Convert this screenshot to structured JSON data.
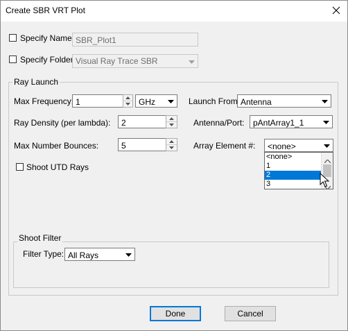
{
  "window": {
    "title": "Create SBR VRT Plot"
  },
  "specify_name": {
    "label": "Specify Name",
    "value": "SBR_Plot1"
  },
  "specify_folder": {
    "label": "Specify Folder",
    "value": "Visual Ray Trace SBR"
  },
  "ray_launch": {
    "group_label": "Ray Launch",
    "max_frequency": {
      "label": "Max Frequency:",
      "value": "1",
      "unit": "GHz"
    },
    "ray_density": {
      "label": "Ray Density (per lambda):",
      "value": "2"
    },
    "max_bounces": {
      "label": "Max Number Bounces:",
      "value": "5"
    },
    "launch_from": {
      "label": "Launch From:",
      "value": "Antenna"
    },
    "antenna_port": {
      "label": "Antenna/Port:",
      "value": "pAntArray1_1"
    },
    "array_element": {
      "label": "Array Element #:",
      "value": "<none>",
      "options": [
        "<none>",
        "1",
        "2",
        "3"
      ],
      "highlighted": "2"
    },
    "shoot_utd": {
      "label": "Shoot UTD Rays"
    }
  },
  "shoot_filter": {
    "group_label": "Shoot Filter",
    "filter_type": {
      "label": "Filter Type:",
      "value": "All Rays"
    }
  },
  "buttons": {
    "done": "Done",
    "cancel": "Cancel"
  }
}
